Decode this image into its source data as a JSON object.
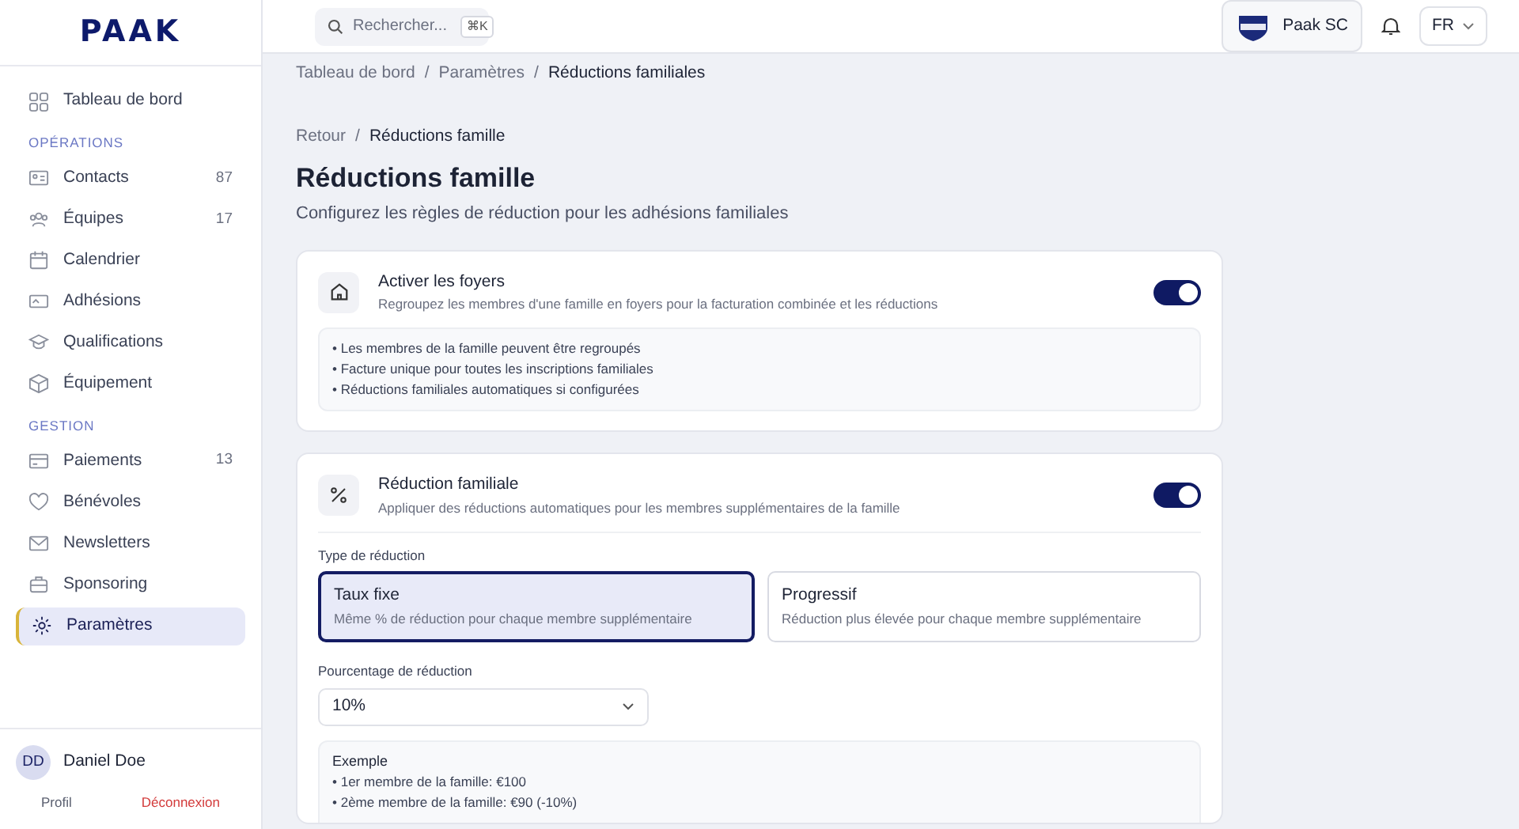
{
  "logo": "PAAK",
  "sidebar": {
    "items": [
      {
        "label": "Tableau de bord",
        "selected": false
      },
      {
        "kind": "section",
        "label": "OPÉRATIONS"
      },
      {
        "label": "Contacts",
        "count": "87",
        "selected": false
      },
      {
        "label": "Équipes",
        "count": "17",
        "selected": false
      },
      {
        "label": "Calendrier",
        "selected": false
      },
      {
        "label": "Adhésions",
        "selected": false
      },
      {
        "label": "Qualifications",
        "selected": false
      },
      {
        "label": "Équipement",
        "selected": false
      },
      {
        "kind": "section",
        "label": "GESTION"
      },
      {
        "label": "Paiements",
        "count": "13",
        "selected": false
      },
      {
        "label": "Bénévoles",
        "selected": false
      },
      {
        "label": "Newsletters",
        "selected": false
      },
      {
        "label": "Sponsoring",
        "selected": false
      },
      {
        "label": "Paramètres",
        "selected": true
      }
    ],
    "user": {
      "initials": "DD",
      "name": "Daniel Doe",
      "profile": "Profil",
      "logout": "Déconnexion"
    }
  },
  "topbar": {
    "search": {
      "placeholder": "Rechercher...",
      "shortcut": "⌘K"
    },
    "club": "Paak SC",
    "language": "FR"
  },
  "breadcrumb": {
    "separator": "/",
    "items": [
      "Tableau de bord",
      "Paramètres",
      "Réductions familiales"
    ]
  },
  "back_breadcrumb": {
    "separator": "/",
    "items": [
      "Retour",
      "Réductions famille"
    ]
  },
  "title": "Réductions famille",
  "subtitle": "Configurez les règles de réduction pour les adhésions familiales",
  "households": {
    "title": "Activer les foyers",
    "description": "Regroupez les membres d'une famille en foyers pour la facturation combinée et les réductions",
    "on": true,
    "bullets": [
      "• Les membres de la famille peuvent être regroupés",
      "• Facture unique pour toutes les inscriptions familiales",
      "• Réductions familiales automatiques si configurées"
    ]
  },
  "family_discount": {
    "title": "Réduction familiale",
    "description": "Appliquer des réductions automatiques pour les membres supplémentaires de la famille",
    "on": true,
    "type_label": "Type de réduction",
    "types": [
      {
        "title": "Taux fixe",
        "description": "Même % de réduction pour chaque membre supplémentaire",
        "selected": true
      },
      {
        "title": "Progressif",
        "description": "Réduction plus élevée pour chaque membre supplémentaire",
        "selected": false
      }
    ],
    "percentage_label": "Pourcentage de réduction",
    "percentage": "10%",
    "example": {
      "title": "Exemple",
      "lines": [
        "• 1er membre de la famille: €100",
        "• 2ème membre de la famille: €90 (-10%)"
      ]
    }
  }
}
